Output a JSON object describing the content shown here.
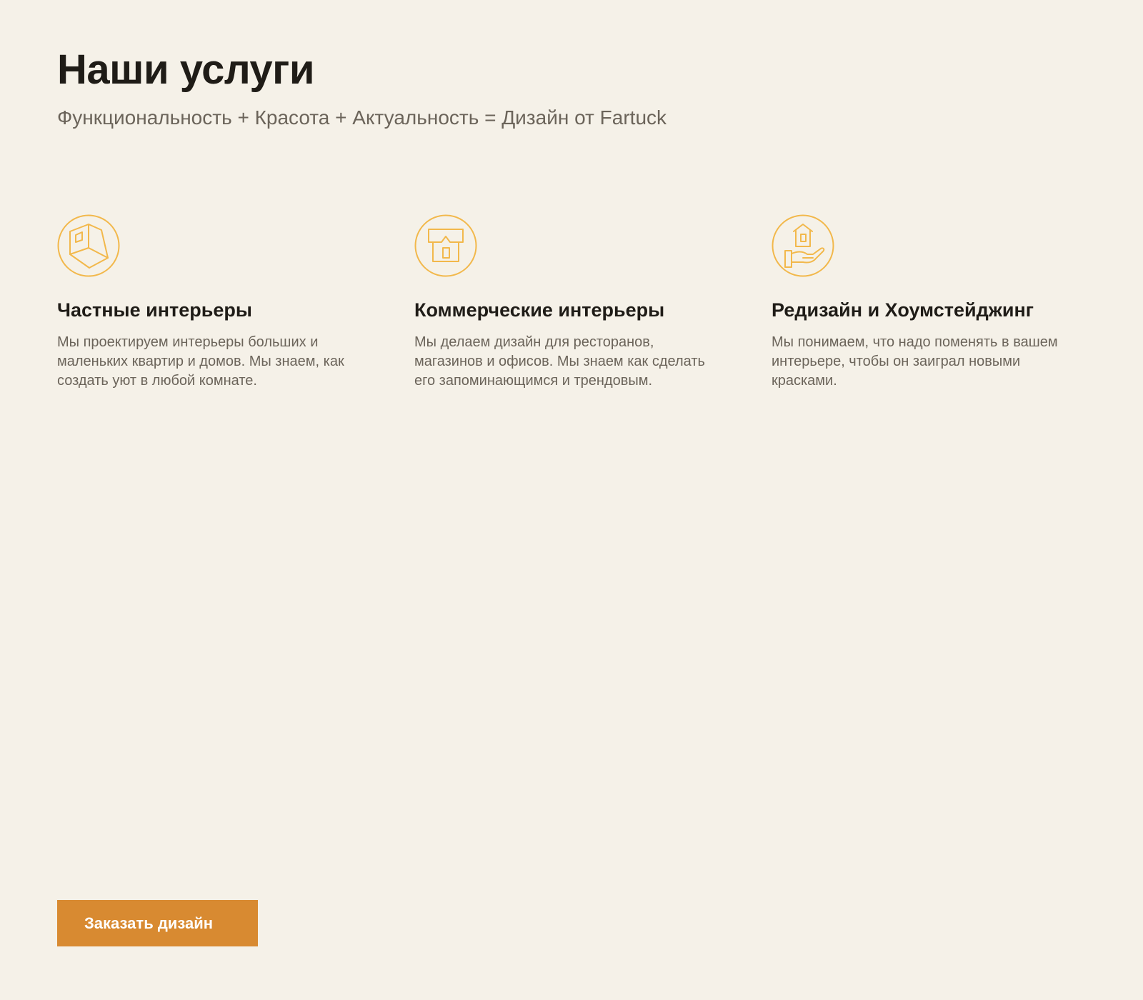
{
  "header": {
    "title": "Наши услуги",
    "subtitle": "Функциональность + Красота + Актуальность = Дизайн от Fartuck"
  },
  "services": [
    {
      "icon": "cube-room-icon",
      "title": "Частные интерьеры",
      "description": "Мы проектируем интерьеры больших и маленьких квартир и домов. Мы знаем, как создать уют в любой комнате."
    },
    {
      "icon": "storefront-icon",
      "title": "Коммерческие интерьеры",
      "description": "Мы делаем дизайн для ресторанов, магазинов и офисов. Мы знаем как сделать его запоминающимся и трендовым."
    },
    {
      "icon": "house-in-hand-icon",
      "title": "Редизайн и Хоумстейджинг",
      "description": "Мы понимаем, что надо поменять в вашем интерьере, чтобы он заиграл новыми красками."
    }
  ],
  "cta": {
    "label": "Заказать дизайн"
  },
  "colors": {
    "background": "#f5f1e8",
    "accent": "#d88a31",
    "icon_stroke": "#f2b84b",
    "heading": "#1f1c17",
    "body_text": "#6b645a"
  }
}
